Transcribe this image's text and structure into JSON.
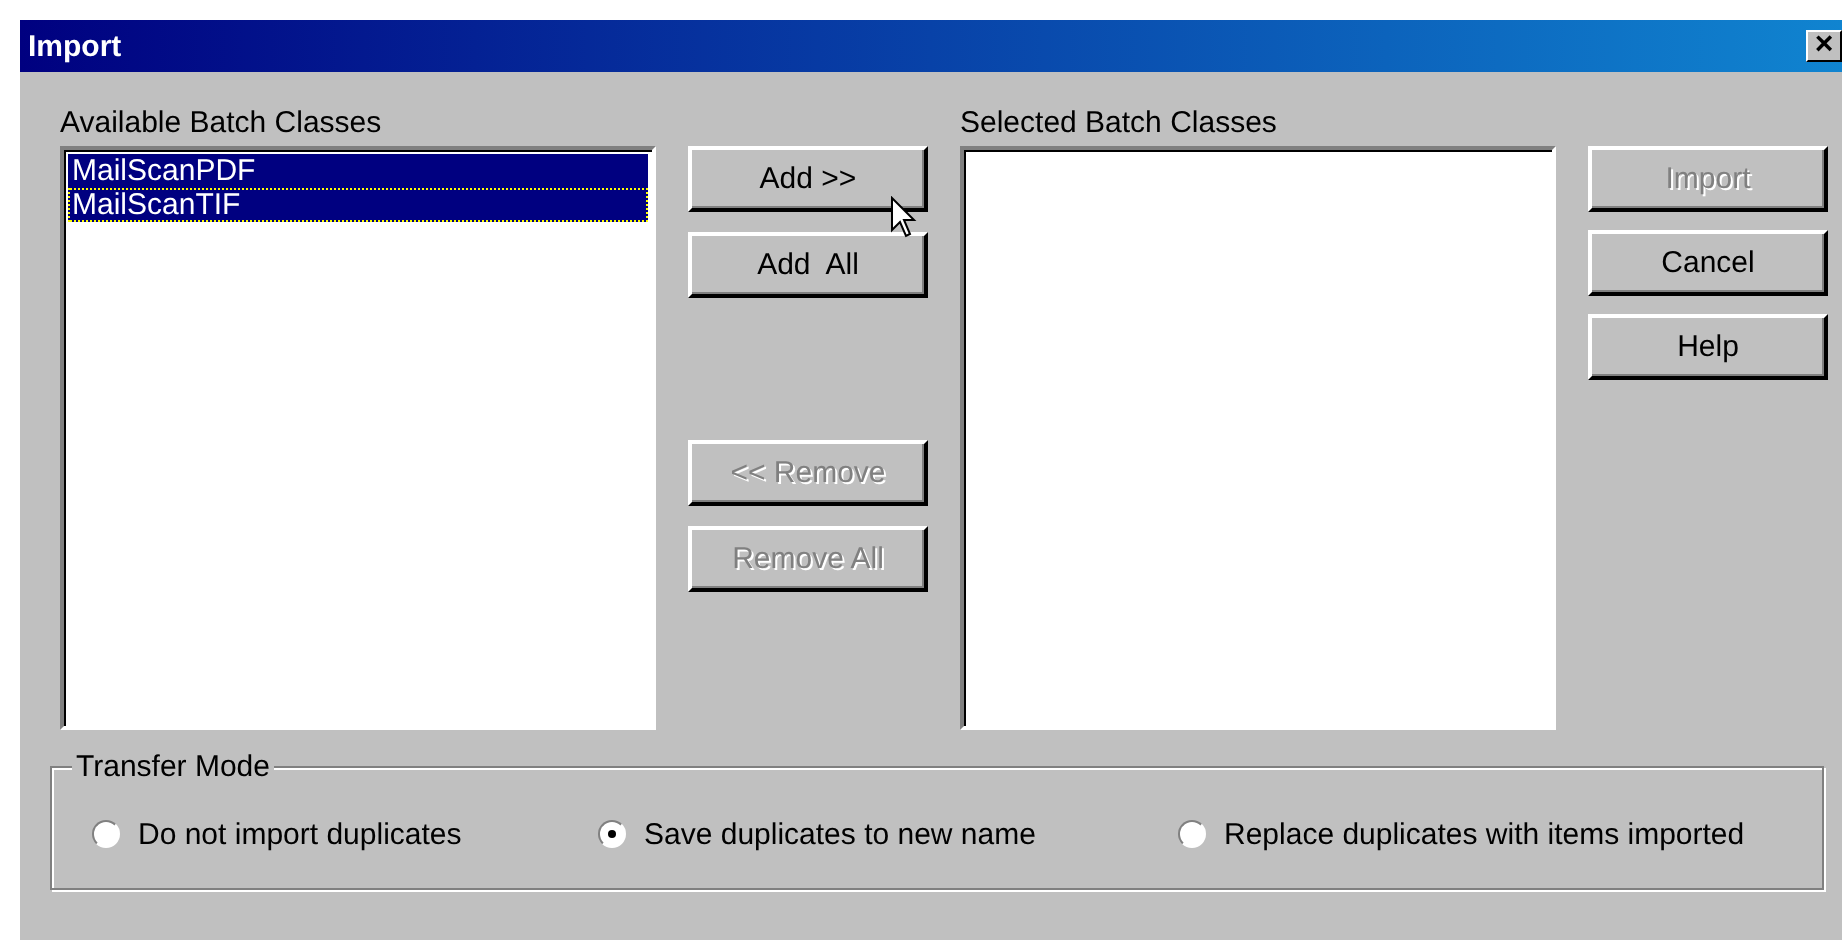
{
  "window": {
    "title": "Import",
    "close": "×"
  },
  "available": {
    "label": "Available Batch Classes",
    "items": [
      {
        "text": "MailScanPDF",
        "selected": true,
        "focused": false
      },
      {
        "text": "MailScanTIF",
        "selected": true,
        "focused": true
      }
    ]
  },
  "move_buttons": [
    {
      "label": "Add >>",
      "disabled": false
    },
    {
      "label": "Add  All",
      "disabled": false
    },
    {
      "label": "<< Remove",
      "disabled": true
    },
    {
      "label": "Remove All",
      "disabled": true
    }
  ],
  "selected_list": {
    "label": "Selected Batch Classes"
  },
  "action_buttons": [
    {
      "label": "Import",
      "disabled": true
    },
    {
      "label": "Cancel",
      "disabled": false
    },
    {
      "label": "Help",
      "disabled": false
    }
  ],
  "transfer_mode": {
    "label": "Transfer Mode",
    "options": [
      {
        "label": "Do not import duplicates",
        "selected": false
      },
      {
        "label": "Save duplicates to new name",
        "selected": true
      },
      {
        "label": "Replace duplicates with items imported",
        "selected": false
      }
    ]
  }
}
